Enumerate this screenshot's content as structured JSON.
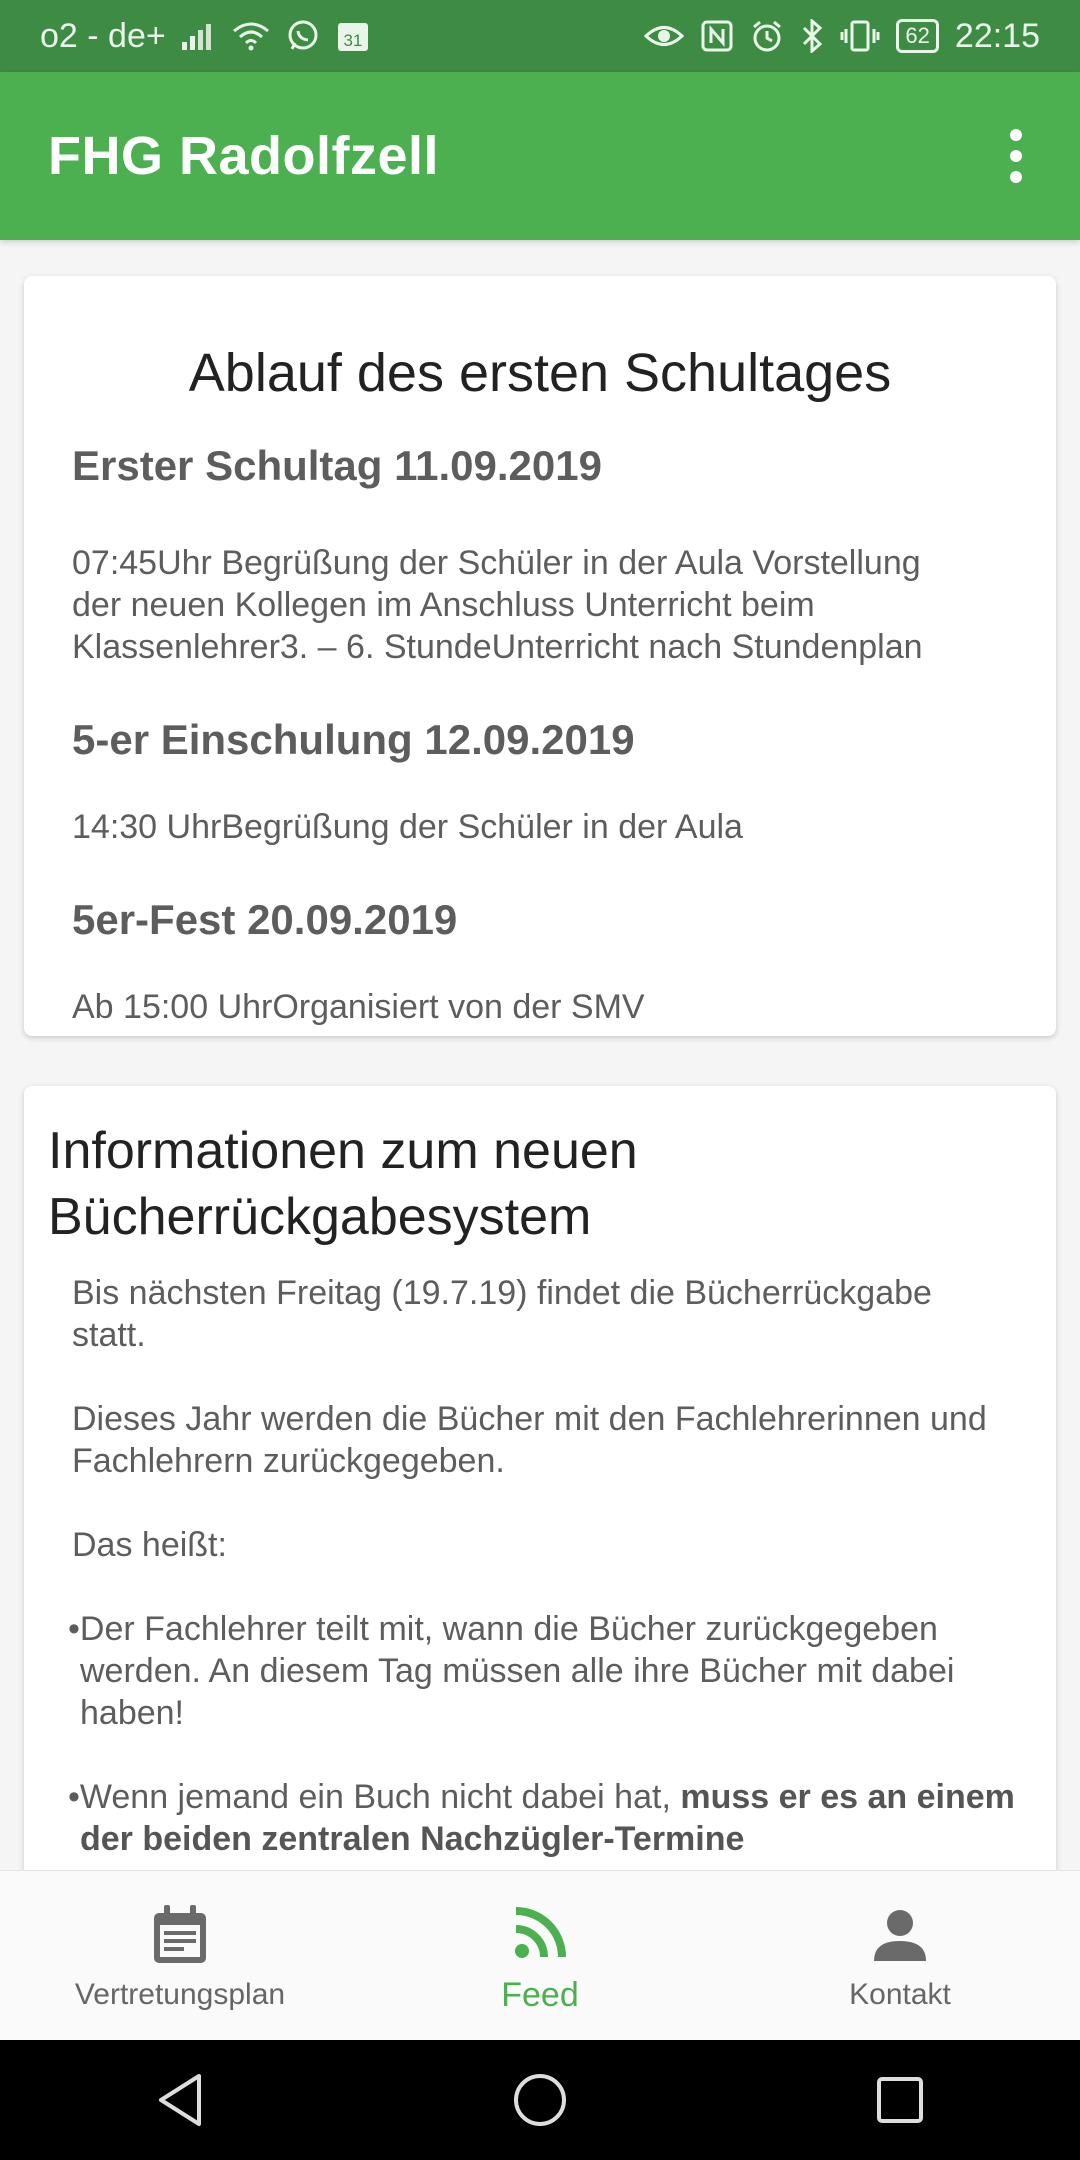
{
  "status_bar": {
    "carrier": "o2 - de+",
    "calendar_day": "31",
    "battery": "62",
    "time": "22:15"
  },
  "app_bar": {
    "title": "FHG Radolfzell"
  },
  "feed": {
    "card1": {
      "title": "Ablauf des ersten Schultages",
      "sections": [
        {
          "heading": "Erster Schultag 11.09.2019",
          "lines": [
            "07:45Uhr Begrüßung der Schüler in der Aula Vorstellung",
            "der neuen Kollegen im Anschluss Unterricht beim",
            "Klassenlehrer3. – 6. StundeUnterricht nach Stundenplan"
          ]
        },
        {
          "heading": "5-er Einschulung 12.09.2019",
          "lines": [
            "14:30 UhrBegrüßung der Schüler in der Aula"
          ]
        },
        {
          "heading": "5er-Fest 20.09.2019",
          "lines": [
            "Ab 15:00 UhrOrganisiert von der SMV"
          ]
        }
      ]
    },
    "card2": {
      "title_line1": "Informationen zum neuen",
      "title_line2": "Bücherrückgabesystem",
      "para1": "Bis nächsten Freitag (19.7.19) findet die Bücherrückgabe statt.",
      "para2": "Dieses Jahr werden die Bücher mit den Fachlehrerinnen und Fachlehrern zurückgegeben.",
      "para3": "Das heißt:",
      "bullet1": "•Der Fachlehrer teilt mit, wann die Bücher zurückgegeben werden. An diesem Tag müssen alle ihre Bücher mit dabei haben!",
      "bullet2_normal": "•Wenn jemand ein Buch nicht dabei hat, ",
      "bullet2_bold": "muss er es an einem der beiden zentralen Nachzügler-Termine"
    }
  },
  "bottom_nav": {
    "items": [
      {
        "label": "Vertretungsplan",
        "icon": "calendar-icon"
      },
      {
        "label": "Feed",
        "icon": "rss-icon"
      },
      {
        "label": "Kontakt",
        "icon": "person-icon"
      }
    ],
    "active_color": "#4caf50",
    "inactive_color": "#666666"
  },
  "theme": {
    "primary": "#4caf50",
    "primary_dark": "#3e8c44"
  }
}
